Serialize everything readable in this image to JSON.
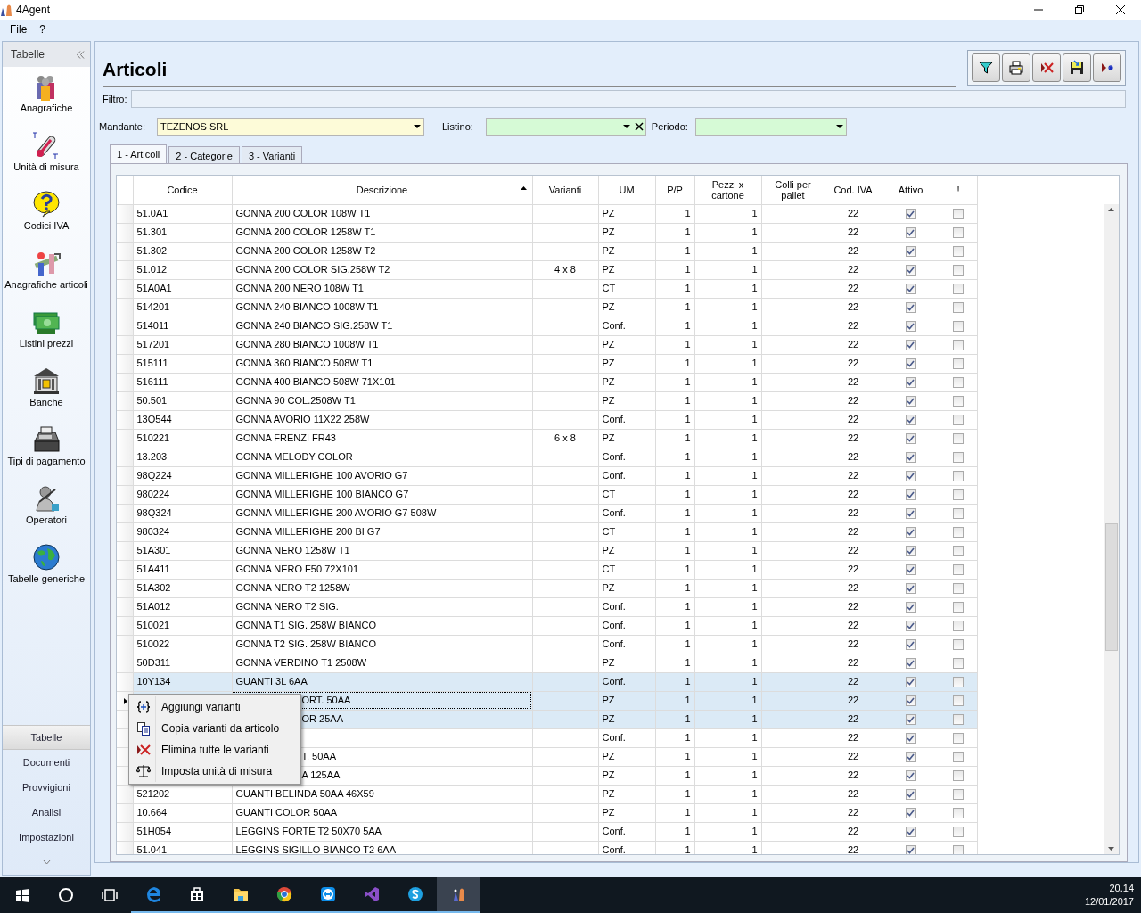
{
  "window": {
    "title": "4Agent"
  },
  "menu": [
    "File",
    "?"
  ],
  "sidebar": {
    "title": "Tabelle",
    "items": [
      {
        "label": "Anagrafiche",
        "kind": "people"
      },
      {
        "label": "Unità di misura",
        "kind": "thermo"
      },
      {
        "label": "Codici IVA",
        "kind": "help"
      },
      {
        "label": "Anagrafiche articoli",
        "kind": "tools"
      },
      {
        "label": "Listini prezzi",
        "kind": "money"
      },
      {
        "label": "Banche",
        "kind": "bank"
      },
      {
        "label": "Tipi di pagamento",
        "kind": "register"
      },
      {
        "label": "Operatori",
        "kind": "operator"
      },
      {
        "label": "Tabelle generiche",
        "kind": "globe"
      }
    ],
    "sections": [
      {
        "label": "Tabelle",
        "selected": true
      },
      {
        "label": "Documenti",
        "selected": false
      },
      {
        "label": "Provvigioni",
        "selected": false
      },
      {
        "label": "Analisi",
        "selected": false
      },
      {
        "label": "Impostazioni",
        "selected": false
      }
    ]
  },
  "page": {
    "title": "Articoli",
    "filter_label": "Filtro:",
    "mandante": {
      "label": "Mandante:",
      "value": "TEZENOS SRL"
    },
    "listino": {
      "label": "Listino:"
    },
    "periodo": {
      "label": "Periodo:"
    },
    "tabs": [
      {
        "label": "1 - Articoli",
        "selected": true
      },
      {
        "label": "2 - Categorie",
        "selected": false
      },
      {
        "label": "3 - Varianti",
        "selected": false
      }
    ]
  },
  "table": {
    "columns": [
      "Codice",
      "Descrizione",
      "Varianti",
      "UM",
      "P/P",
      "Pezzi x cartone",
      "Colli per pallet",
      "Cod. IVA",
      "Attivo",
      "!"
    ],
    "rows": [
      {
        "code": "51.0A1",
        "desc": "GONNA 200 COLOR 108W T1",
        "um": "PZ",
        "pp": "1",
        "pezzi": "1",
        "iva": "22",
        "attivo": true,
        "alert": false,
        "selected": false,
        "current": false,
        "covered": false
      },
      {
        "code": "51.301",
        "desc": "GONNA 200 COLOR 1258W T1",
        "um": "PZ",
        "pp": "1",
        "pezzi": "1",
        "iva": "22",
        "attivo": true,
        "alert": false,
        "selected": false,
        "current": false,
        "covered": false
      },
      {
        "code": "51.302",
        "desc": "GONNA 200 COLOR 1258W T2",
        "um": "PZ",
        "pp": "1",
        "pezzi": "1",
        "iva": "22",
        "attivo": true,
        "alert": false,
        "selected": false,
        "current": false,
        "covered": false
      },
      {
        "code": "51.012",
        "desc": "GONNA 200 COLOR SIG.258W T2",
        "varianti": "4 x 8",
        "um": "PZ",
        "pp": "1",
        "pezzi": "1",
        "iva": "22",
        "attivo": true,
        "alert": false,
        "selected": false,
        "current": false,
        "covered": false
      },
      {
        "code": "51A0A1",
        "desc": "GONNA 200 NERO 108W T1",
        "um": "CT",
        "pp": "1",
        "pezzi": "1",
        "iva": "22",
        "attivo": true,
        "alert": false,
        "selected": false,
        "current": false,
        "covered": false
      },
      {
        "code": "514201",
        "desc": "GONNA 240 BIANCO 1008W T1",
        "um": "PZ",
        "pp": "1",
        "pezzi": "1",
        "iva": "22",
        "attivo": true,
        "alert": false,
        "selected": false,
        "current": false,
        "covered": false
      },
      {
        "code": "514011",
        "desc": "GONNA 240 BIANCO SIG.258W T1",
        "um": "Conf.",
        "pp": "1",
        "pezzi": "1",
        "iva": "22",
        "attivo": true,
        "alert": false,
        "selected": false,
        "current": false,
        "covered": false
      },
      {
        "code": "517201",
        "desc": "GONNA 280 BIANCO 1008W T1",
        "um": "PZ",
        "pp": "1",
        "pezzi": "1",
        "iva": "22",
        "attivo": true,
        "alert": false,
        "selected": false,
        "current": false,
        "covered": false
      },
      {
        "code": "515111",
        "desc": "GONNA 360 BIANCO 508W T1",
        "um": "PZ",
        "pp": "1",
        "pezzi": "1",
        "iva": "22",
        "attivo": true,
        "alert": false,
        "selected": false,
        "current": false,
        "covered": false
      },
      {
        "code": "516111",
        "desc": "GONNA 400 BIANCO 508W 71X101",
        "um": "PZ",
        "pp": "1",
        "pezzi": "1",
        "iva": "22",
        "attivo": true,
        "alert": false,
        "selected": false,
        "current": false,
        "covered": false
      },
      {
        "code": "50.501",
        "desc": "GONNA 90 COL.2508W T1",
        "um": "PZ",
        "pp": "1",
        "pezzi": "1",
        "iva": "22",
        "attivo": true,
        "alert": false,
        "selected": false,
        "current": false,
        "covered": false
      },
      {
        "code": "13Q544",
        "desc": "GONNA AVORIO 11X22 258W",
        "um": "Conf.",
        "pp": "1",
        "pezzi": "1",
        "iva": "22",
        "attivo": true,
        "alert": false,
        "selected": false,
        "current": false,
        "covered": false
      },
      {
        "code": "510221",
        "desc": "GONNA FRENZI FR43",
        "varianti": "6 x 8",
        "um": "PZ",
        "pp": "1",
        "pezzi": "1",
        "iva": "22",
        "attivo": true,
        "alert": false,
        "selected": false,
        "current": false,
        "covered": false
      },
      {
        "code": "13.203",
        "desc": "GONNA MELODY COLOR",
        "um": "Conf.",
        "pp": "1",
        "pezzi": "1",
        "iva": "22",
        "attivo": true,
        "alert": false,
        "selected": false,
        "current": false,
        "covered": false
      },
      {
        "code": "98Q224",
        "desc": "GONNA MILLERIGHE 100 AVORIO G7",
        "um": "Conf.",
        "pp": "1",
        "pezzi": "1",
        "iva": "22",
        "attivo": true,
        "alert": false,
        "selected": false,
        "current": false,
        "covered": false
      },
      {
        "code": "980224",
        "desc": "GONNA MILLERIGHE 100 BIANCO G7",
        "um": "CT",
        "pp": "1",
        "pezzi": "1",
        "iva": "22",
        "attivo": true,
        "alert": false,
        "selected": false,
        "current": false,
        "covered": false
      },
      {
        "code": "98Q324",
        "desc": "GONNA MILLERIGHE 200 AVORIO G7 508W",
        "um": "Conf.",
        "pp": "1",
        "pezzi": "1",
        "iva": "22",
        "attivo": true,
        "alert": false,
        "selected": false,
        "current": false,
        "covered": false
      },
      {
        "code": "980324",
        "desc": "GONNA MILLERIGHE 200 BI G7",
        "um": "CT",
        "pp": "1",
        "pezzi": "1",
        "iva": "22",
        "attivo": true,
        "alert": false,
        "selected": false,
        "current": false,
        "covered": false
      },
      {
        "code": "51A301",
        "desc": "GONNA NERO 1258W T1",
        "um": "PZ",
        "pp": "1",
        "pezzi": "1",
        "iva": "22",
        "attivo": true,
        "alert": false,
        "selected": false,
        "current": false,
        "covered": false
      },
      {
        "code": "51A411",
        "desc": "GONNA NERO F50 72X101",
        "um": "CT",
        "pp": "1",
        "pezzi": "1",
        "iva": "22",
        "attivo": true,
        "alert": false,
        "selected": false,
        "current": false,
        "covered": false
      },
      {
        "code": "51A302",
        "desc": "GONNA NERO T2 1258W",
        "um": "PZ",
        "pp": "1",
        "pezzi": "1",
        "iva": "22",
        "attivo": true,
        "alert": false,
        "selected": false,
        "current": false,
        "covered": false
      },
      {
        "code": "51A012",
        "desc": "GONNA NERO T2 SIG.",
        "um": "Conf.",
        "pp": "1",
        "pezzi": "1",
        "iva": "22",
        "attivo": true,
        "alert": false,
        "selected": false,
        "current": false,
        "covered": false
      },
      {
        "code": "510021",
        "desc": "GONNA T1 SIG. 258W BIANCO",
        "um": "Conf.",
        "pp": "1",
        "pezzi": "1",
        "iva": "22",
        "attivo": true,
        "alert": false,
        "selected": false,
        "current": false,
        "covered": false
      },
      {
        "code": "510022",
        "desc": "GONNA T2 SIG. 258W BIANCO",
        "um": "Conf.",
        "pp": "1",
        "pezzi": "1",
        "iva": "22",
        "attivo": true,
        "alert": false,
        "selected": false,
        "current": false,
        "covered": false
      },
      {
        "code": "50D311",
        "desc": "GONNA VERDINO T1 2508W",
        "um": "PZ",
        "pp": "1",
        "pezzi": "1",
        "iva": "22",
        "attivo": true,
        "alert": false,
        "selected": false,
        "current": false,
        "covered": false
      },
      {
        "code": "10Y134",
        "desc": "GUANTI 3L 6AA",
        "um": "Conf.",
        "pp": "1",
        "pezzi": "1",
        "iva": "22",
        "attivo": true,
        "alert": false,
        "selected": true,
        "current": false,
        "covered": false
      },
      {
        "desc": "ORT. 50AA",
        "um": "PZ",
        "pp": "1",
        "pezzi": "1",
        "iva": "22",
        "attivo": true,
        "alert": false,
        "selected": true,
        "current": true,
        "covered": true
      },
      {
        "desc": "OR 25AA",
        "um": "PZ",
        "pp": "1",
        "pezzi": "1",
        "iva": "22",
        "attivo": true,
        "alert": false,
        "selected": true,
        "current": false,
        "covered": true
      },
      {
        "um": "Conf.",
        "pp": "1",
        "pezzi": "1",
        "iva": "22",
        "attivo": true,
        "alert": false,
        "selected": false,
        "current": false,
        "covered": true
      },
      {
        "desc": "T. 50AA",
        "um": "PZ",
        "pp": "1",
        "pezzi": "1",
        "iva": "22",
        "attivo": true,
        "alert": false,
        "selected": false,
        "current": false,
        "covered": true
      },
      {
        "desc": "A 125AA",
        "um": "PZ",
        "pp": "1",
        "pezzi": "1",
        "iva": "22",
        "attivo": true,
        "alert": false,
        "selected": false,
        "current": false,
        "covered": true
      },
      {
        "code": "521202",
        "desc": "GUANTI BELINDA 50AA 46X59",
        "um": "PZ",
        "pp": "1",
        "pezzi": "1",
        "iva": "22",
        "attivo": true,
        "alert": false,
        "selected": false,
        "current": false,
        "covered": false
      },
      {
        "code": "10.664",
        "desc": "GUANTI COLOR 50AA",
        "um": "PZ",
        "pp": "1",
        "pezzi": "1",
        "iva": "22",
        "attivo": true,
        "alert": false,
        "selected": false,
        "current": false,
        "covered": false
      },
      {
        "code": "51H054",
        "desc": "LEGGINS FORTE T2 50X70 5AA",
        "um": "Conf.",
        "pp": "1",
        "pezzi": "1",
        "iva": "22",
        "attivo": true,
        "alert": false,
        "selected": false,
        "current": false,
        "covered": false
      },
      {
        "code": "51.041",
        "desc": "LEGGINS SIGILLO BIANCO T2 6AA",
        "um": "Conf.",
        "pp": "1",
        "pezzi": "1",
        "iva": "22",
        "attivo": true,
        "alert": false,
        "selected": false,
        "current": false,
        "covered": false
      }
    ]
  },
  "context_menu": [
    {
      "label": "Aggiungi varianti",
      "kind": "add"
    },
    {
      "label": "Copia varianti da articolo",
      "kind": "copy"
    },
    {
      "label": "Elimina tutte le varianti",
      "kind": "delete"
    },
    {
      "label": "Imposta unità di misura",
      "kind": "scale"
    }
  ],
  "taskbar": {
    "time": "20.14",
    "date": "12/01/2017"
  }
}
